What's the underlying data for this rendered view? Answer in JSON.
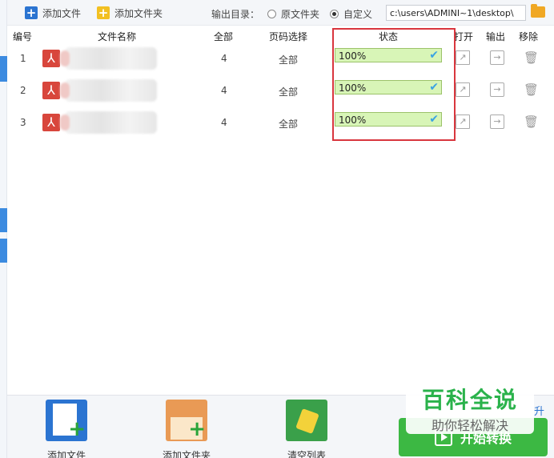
{
  "toolbar": {
    "add_file": "添加文件",
    "add_folder": "添加文件夹",
    "output_label": "输出目录：",
    "radio_original": "原文件夹",
    "radio_custom": "自定义",
    "selected_output": "自定义",
    "output_path": "c:\\users\\ADMINI~1\\desktop\\"
  },
  "columns": {
    "index": "编号",
    "name": "文件名称",
    "total": "全部",
    "page_select": "页码选择",
    "status": "状态",
    "open": "打开",
    "output": "输出",
    "remove": "移除"
  },
  "rows": [
    {
      "index": "1",
      "name": "",
      "total": "4",
      "page_select": "全部",
      "status": "100%",
      "progress": 1.0
    },
    {
      "index": "2",
      "name": "",
      "total": "4",
      "page_select": "全部",
      "status": "100%",
      "progress": 1.0
    },
    {
      "index": "3",
      "name": "",
      "total": "4",
      "page_select": "全部",
      "status": "100%",
      "progress": 1.0
    }
  ],
  "bottom": {
    "add_file": "添加文件",
    "add_folder": "添加文件夹",
    "clear_list": "清空列表",
    "start": "开始转换"
  },
  "watermark": {
    "line1": "百科全说",
    "line2": "助你轻松解决",
    "side": "升"
  },
  "colors": {
    "highlight": "#d9363e",
    "progress_fill": "#d8f5b7",
    "check": "#3aa3e3",
    "start_button": "#3cb843",
    "pdf_icon": "#d8463c"
  },
  "icons": [
    "add-file-icon",
    "add-folder-icon",
    "folder-icon",
    "pdf-icon",
    "check-icon",
    "open-icon",
    "export-icon",
    "trash-icon",
    "clear-list-icon",
    "play-icon"
  ]
}
